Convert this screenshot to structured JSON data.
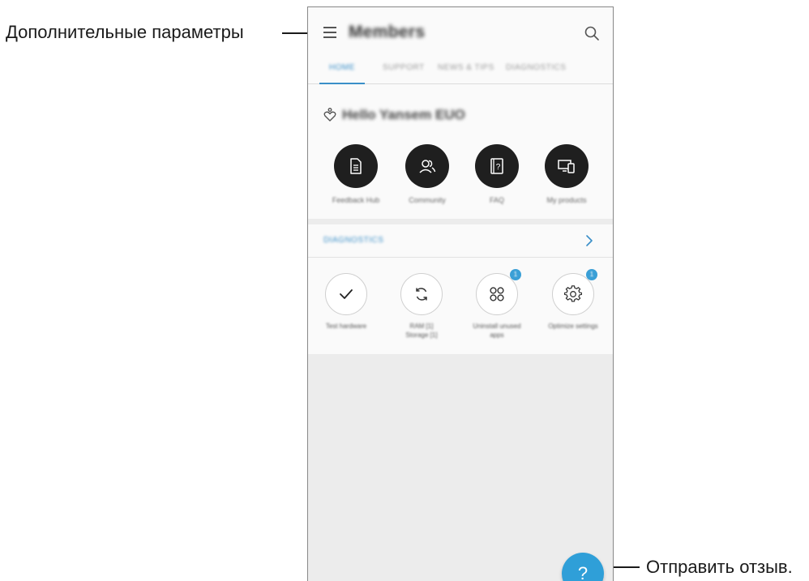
{
  "callouts": {
    "more_options": "Дополнительные параметры",
    "send_feedback": "Отправить отзыв."
  },
  "app": {
    "title": "Members",
    "menu_icon": "hamburger-menu-icon",
    "search_icon": "search-icon"
  },
  "tabs": [
    {
      "label": "Home",
      "active": true
    },
    {
      "label": "Support",
      "active": false
    },
    {
      "label": "News & Tips",
      "active": false
    },
    {
      "label": "Diagnostics",
      "active": false
    }
  ],
  "greeting": "Hello Yansem EUO",
  "actions": [
    {
      "label": "Feedback Hub",
      "icon": "document-icon"
    },
    {
      "label": "Community",
      "icon": "people-icon"
    },
    {
      "label": "FAQ",
      "icon": "faq-icon"
    },
    {
      "label": "My products",
      "icon": "devices-icon"
    }
  ],
  "diagnostics": {
    "title": "Diagnostics",
    "items": [
      {
        "label": "Test hardware",
        "icon": "check-icon",
        "badge": ""
      },
      {
        "label": "RAM [1] Storage [1]",
        "icon": "refresh-icon",
        "badge": ""
      },
      {
        "label": "Uninstall unused apps",
        "icon": "apps-grid-icon",
        "badge": "1"
      },
      {
        "label": "Optimize settings",
        "icon": "gear-icon",
        "badge": "1"
      }
    ]
  },
  "fab": {
    "label": "?"
  },
  "colors": {
    "accent": "#3a8fc8",
    "fab": "#2f9fd8",
    "action_circle": "#1f1f1f",
    "background": "#ececec"
  }
}
